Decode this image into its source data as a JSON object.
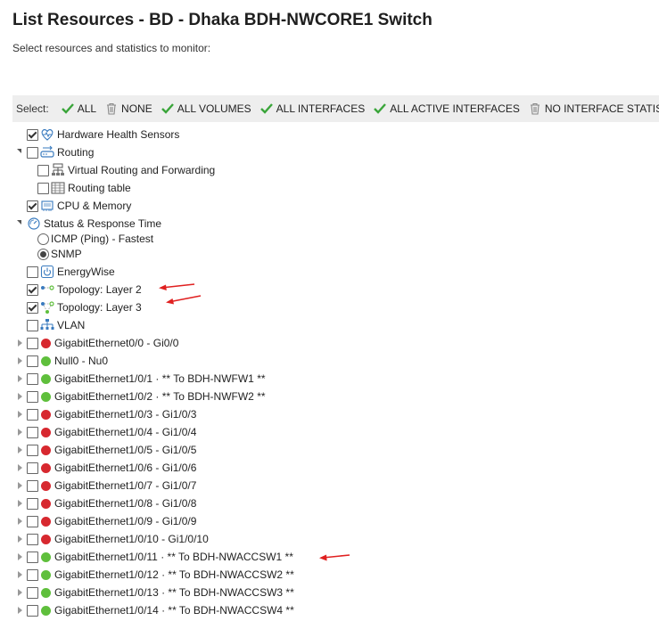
{
  "page": {
    "title": "List Resources - BD - Dhaka BDH-NWCORE1 Switch",
    "subtitle": "Select resources and statistics to monitor:"
  },
  "toolbar": {
    "select_label": "Select:",
    "buttons": [
      {
        "label": "ALL",
        "icon": "check-icon"
      },
      {
        "label": "NONE",
        "icon": "trash-icon"
      },
      {
        "label": "ALL VOLUMES",
        "icon": "check-icon"
      },
      {
        "label": "ALL INTERFACES",
        "icon": "check-icon"
      },
      {
        "label": "ALL ACTIVE INTERFACES",
        "icon": "check-icon"
      },
      {
        "label": "NO INTERFACE STATISTICS",
        "icon": "trash-icon"
      }
    ]
  },
  "tree": {
    "hardware": {
      "label": "Hardware Health Sensors",
      "checked": true,
      "icon": "heartbeat-icon"
    },
    "routing": {
      "label": "Routing",
      "checked": false,
      "icon": "router-icon"
    },
    "vrf": {
      "label": "Virtual Routing and Forwarding",
      "checked": false,
      "icon": "vrf-icon"
    },
    "routing_table": {
      "label": "Routing table",
      "checked": false,
      "icon": "table-icon"
    },
    "cpu": {
      "label": "CPU & Memory",
      "checked": true,
      "icon": "chip-icon"
    },
    "status": {
      "label": "Status & Response Time",
      "icon": "gauge-icon"
    },
    "icmp": {
      "label": "ICMP (Ping) - Fastest",
      "selected": false
    },
    "snmp": {
      "label": "SNMP",
      "selected": true
    },
    "energywise": {
      "label": "EnergyWise",
      "checked": false,
      "icon": "power-icon"
    },
    "topo2": {
      "label": "Topology: Layer 2",
      "checked": true,
      "icon": "topology-icon"
    },
    "topo3": {
      "label": "Topology: Layer 3",
      "checked": true,
      "icon": "topology-icon"
    },
    "vlan": {
      "label": "VLAN",
      "checked": false,
      "icon": "vlan-icon"
    },
    "interfaces": [
      {
        "label": "GigabitEthernet0/0 - Gi0/0",
        "status": "down"
      },
      {
        "label": "Null0 - Nu0",
        "status": "up"
      },
      {
        "label": "GigabitEthernet1/0/1 · ** To BDH-NWFW1 **",
        "status": "up"
      },
      {
        "label": "GigabitEthernet1/0/2 · ** To BDH-NWFW2 **",
        "status": "up"
      },
      {
        "label": "GigabitEthernet1/0/3 - Gi1/0/3",
        "status": "down"
      },
      {
        "label": "GigabitEthernet1/0/4 - Gi1/0/4",
        "status": "down"
      },
      {
        "label": "GigabitEthernet1/0/5 - Gi1/0/5",
        "status": "down"
      },
      {
        "label": "GigabitEthernet1/0/6 - Gi1/0/6",
        "status": "down"
      },
      {
        "label": "GigabitEthernet1/0/7 - Gi1/0/7",
        "status": "down"
      },
      {
        "label": "GigabitEthernet1/0/8 - Gi1/0/8",
        "status": "down"
      },
      {
        "label": "GigabitEthernet1/0/9 - Gi1/0/9",
        "status": "down"
      },
      {
        "label": "GigabitEthernet1/0/10 - Gi1/0/10",
        "status": "down"
      },
      {
        "label": "GigabitEthernet1/0/11 · ** To BDH-NWACCSW1 **",
        "status": "up"
      },
      {
        "label": "GigabitEthernet1/0/12 · ** To BDH-NWACCSW2 **",
        "status": "up"
      },
      {
        "label": "GigabitEthernet1/0/13 · ** To BDH-NWACCSW3 **",
        "status": "up"
      },
      {
        "label": "GigabitEthernet1/0/14 · ** To BDH-NWACCSW4 **",
        "status": "up"
      }
    ]
  },
  "colors": {
    "status_up": "#5fbf3c",
    "status_down": "#d7282f",
    "check_green": "#3aa53a",
    "annotation_arrow": "#e02020"
  }
}
